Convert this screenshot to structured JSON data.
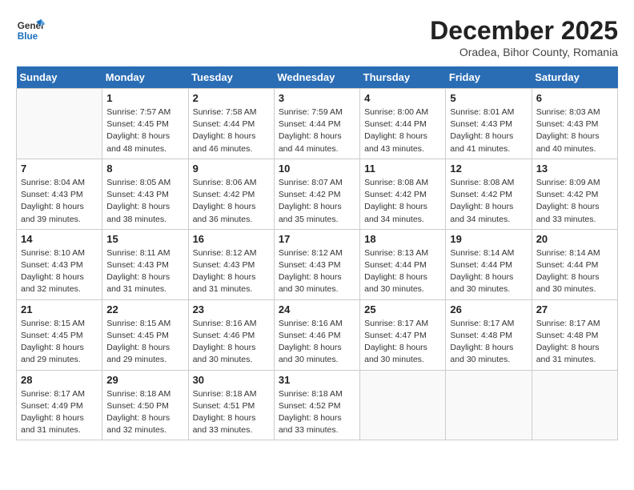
{
  "logo": {
    "line1": "General",
    "line2": "Blue"
  },
  "title": "December 2025",
  "location": "Oradea, Bihor County, Romania",
  "days_header": [
    "Sunday",
    "Monday",
    "Tuesday",
    "Wednesday",
    "Thursday",
    "Friday",
    "Saturday"
  ],
  "weeks": [
    [
      {
        "num": "",
        "sunrise": "",
        "sunset": "",
        "daylight": ""
      },
      {
        "num": "1",
        "sunrise": "Sunrise: 7:57 AM",
        "sunset": "Sunset: 4:45 PM",
        "daylight": "Daylight: 8 hours and 48 minutes."
      },
      {
        "num": "2",
        "sunrise": "Sunrise: 7:58 AM",
        "sunset": "Sunset: 4:44 PM",
        "daylight": "Daylight: 8 hours and 46 minutes."
      },
      {
        "num": "3",
        "sunrise": "Sunrise: 7:59 AM",
        "sunset": "Sunset: 4:44 PM",
        "daylight": "Daylight: 8 hours and 44 minutes."
      },
      {
        "num": "4",
        "sunrise": "Sunrise: 8:00 AM",
        "sunset": "Sunset: 4:44 PM",
        "daylight": "Daylight: 8 hours and 43 minutes."
      },
      {
        "num": "5",
        "sunrise": "Sunrise: 8:01 AM",
        "sunset": "Sunset: 4:43 PM",
        "daylight": "Daylight: 8 hours and 41 minutes."
      },
      {
        "num": "6",
        "sunrise": "Sunrise: 8:03 AM",
        "sunset": "Sunset: 4:43 PM",
        "daylight": "Daylight: 8 hours and 40 minutes."
      }
    ],
    [
      {
        "num": "7",
        "sunrise": "Sunrise: 8:04 AM",
        "sunset": "Sunset: 4:43 PM",
        "daylight": "Daylight: 8 hours and 39 minutes."
      },
      {
        "num": "8",
        "sunrise": "Sunrise: 8:05 AM",
        "sunset": "Sunset: 4:43 PM",
        "daylight": "Daylight: 8 hours and 38 minutes."
      },
      {
        "num": "9",
        "sunrise": "Sunrise: 8:06 AM",
        "sunset": "Sunset: 4:42 PM",
        "daylight": "Daylight: 8 hours and 36 minutes."
      },
      {
        "num": "10",
        "sunrise": "Sunrise: 8:07 AM",
        "sunset": "Sunset: 4:42 PM",
        "daylight": "Daylight: 8 hours and 35 minutes."
      },
      {
        "num": "11",
        "sunrise": "Sunrise: 8:08 AM",
        "sunset": "Sunset: 4:42 PM",
        "daylight": "Daylight: 8 hours and 34 minutes."
      },
      {
        "num": "12",
        "sunrise": "Sunrise: 8:08 AM",
        "sunset": "Sunset: 4:42 PM",
        "daylight": "Daylight: 8 hours and 34 minutes."
      },
      {
        "num": "13",
        "sunrise": "Sunrise: 8:09 AM",
        "sunset": "Sunset: 4:42 PM",
        "daylight": "Daylight: 8 hours and 33 minutes."
      }
    ],
    [
      {
        "num": "14",
        "sunrise": "Sunrise: 8:10 AM",
        "sunset": "Sunset: 4:43 PM",
        "daylight": "Daylight: 8 hours and 32 minutes."
      },
      {
        "num": "15",
        "sunrise": "Sunrise: 8:11 AM",
        "sunset": "Sunset: 4:43 PM",
        "daylight": "Daylight: 8 hours and 31 minutes."
      },
      {
        "num": "16",
        "sunrise": "Sunrise: 8:12 AM",
        "sunset": "Sunset: 4:43 PM",
        "daylight": "Daylight: 8 hours and 31 minutes."
      },
      {
        "num": "17",
        "sunrise": "Sunrise: 8:12 AM",
        "sunset": "Sunset: 4:43 PM",
        "daylight": "Daylight: 8 hours and 30 minutes."
      },
      {
        "num": "18",
        "sunrise": "Sunrise: 8:13 AM",
        "sunset": "Sunset: 4:44 PM",
        "daylight": "Daylight: 8 hours and 30 minutes."
      },
      {
        "num": "19",
        "sunrise": "Sunrise: 8:14 AM",
        "sunset": "Sunset: 4:44 PM",
        "daylight": "Daylight: 8 hours and 30 minutes."
      },
      {
        "num": "20",
        "sunrise": "Sunrise: 8:14 AM",
        "sunset": "Sunset: 4:44 PM",
        "daylight": "Daylight: 8 hours and 30 minutes."
      }
    ],
    [
      {
        "num": "21",
        "sunrise": "Sunrise: 8:15 AM",
        "sunset": "Sunset: 4:45 PM",
        "daylight": "Daylight: 8 hours and 29 minutes."
      },
      {
        "num": "22",
        "sunrise": "Sunrise: 8:15 AM",
        "sunset": "Sunset: 4:45 PM",
        "daylight": "Daylight: 8 hours and 29 minutes."
      },
      {
        "num": "23",
        "sunrise": "Sunrise: 8:16 AM",
        "sunset": "Sunset: 4:46 PM",
        "daylight": "Daylight: 8 hours and 30 minutes."
      },
      {
        "num": "24",
        "sunrise": "Sunrise: 8:16 AM",
        "sunset": "Sunset: 4:46 PM",
        "daylight": "Daylight: 8 hours and 30 minutes."
      },
      {
        "num": "25",
        "sunrise": "Sunrise: 8:17 AM",
        "sunset": "Sunset: 4:47 PM",
        "daylight": "Daylight: 8 hours and 30 minutes."
      },
      {
        "num": "26",
        "sunrise": "Sunrise: 8:17 AM",
        "sunset": "Sunset: 4:48 PM",
        "daylight": "Daylight: 8 hours and 30 minutes."
      },
      {
        "num": "27",
        "sunrise": "Sunrise: 8:17 AM",
        "sunset": "Sunset: 4:48 PM",
        "daylight": "Daylight: 8 hours and 31 minutes."
      }
    ],
    [
      {
        "num": "28",
        "sunrise": "Sunrise: 8:17 AM",
        "sunset": "Sunset: 4:49 PM",
        "daylight": "Daylight: 8 hours and 31 minutes."
      },
      {
        "num": "29",
        "sunrise": "Sunrise: 8:18 AM",
        "sunset": "Sunset: 4:50 PM",
        "daylight": "Daylight: 8 hours and 32 minutes."
      },
      {
        "num": "30",
        "sunrise": "Sunrise: 8:18 AM",
        "sunset": "Sunset: 4:51 PM",
        "daylight": "Daylight: 8 hours and 33 minutes."
      },
      {
        "num": "31",
        "sunrise": "Sunrise: 8:18 AM",
        "sunset": "Sunset: 4:52 PM",
        "daylight": "Daylight: 8 hours and 33 minutes."
      },
      {
        "num": "",
        "sunrise": "",
        "sunset": "",
        "daylight": ""
      },
      {
        "num": "",
        "sunrise": "",
        "sunset": "",
        "daylight": ""
      },
      {
        "num": "",
        "sunrise": "",
        "sunset": "",
        "daylight": ""
      }
    ]
  ]
}
